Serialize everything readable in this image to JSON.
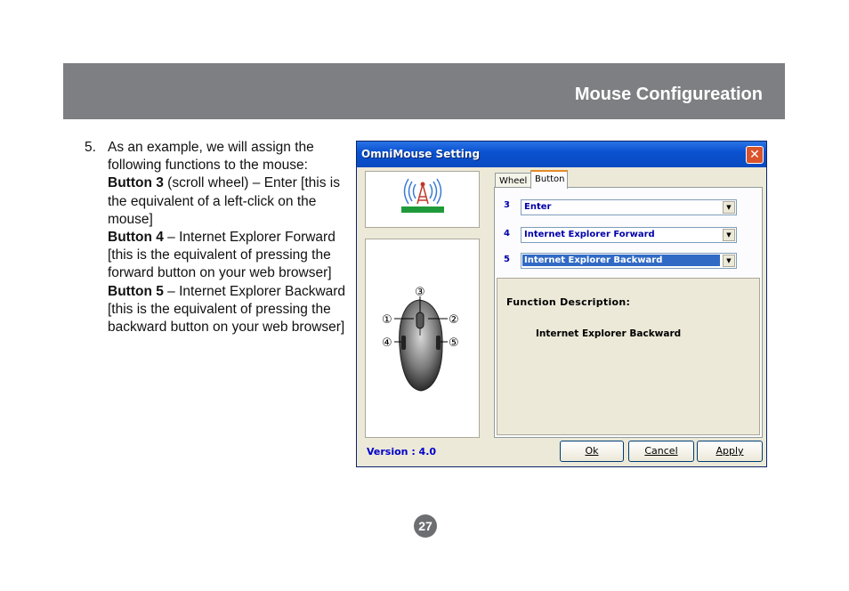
{
  "header": {
    "title": "Mouse Configureation"
  },
  "step": {
    "number": "5.",
    "intro": "As an example, we will assign the following functions to the mouse:",
    "button3_label": "Button 3",
    "button3_text": " (scroll wheel) – Enter [this is the equivalent of a left-click on the mouse]",
    "button4_label": "Button 4",
    "button4_text": " – Internet Explorer Forward [this is the equivalent of pressing the forward button on your web browser]",
    "button5_label": "Button 5",
    "button5_text": " – Internet Explorer Backward [this is the equivalent of pressing the backward button on your web browser]"
  },
  "dialog": {
    "title": "OmniMouse Setting",
    "close": "✕",
    "version": "Version : 4.0",
    "tabs": [
      "Wheel",
      "Button"
    ],
    "mouse_labels": [
      "①",
      "②",
      "③",
      "④",
      "⑤"
    ],
    "rows": [
      {
        "num": "3",
        "value": "Enter"
      },
      {
        "num": "4",
        "value": "Internet Explorer Forward"
      },
      {
        "num": "5",
        "value": "Internet Explorer Backward"
      }
    ],
    "function_description_label": "Function Description:",
    "function_description_value": "Internet Explorer Backward",
    "buttons": {
      "ok": "Ok",
      "cancel": "Cancel",
      "apply": "Apply"
    }
  },
  "page_number": "27",
  "colors": {
    "header_bg": "#7d7f82",
    "titlebar": "#0a52d0",
    "accent_text": "#0000aa"
  }
}
